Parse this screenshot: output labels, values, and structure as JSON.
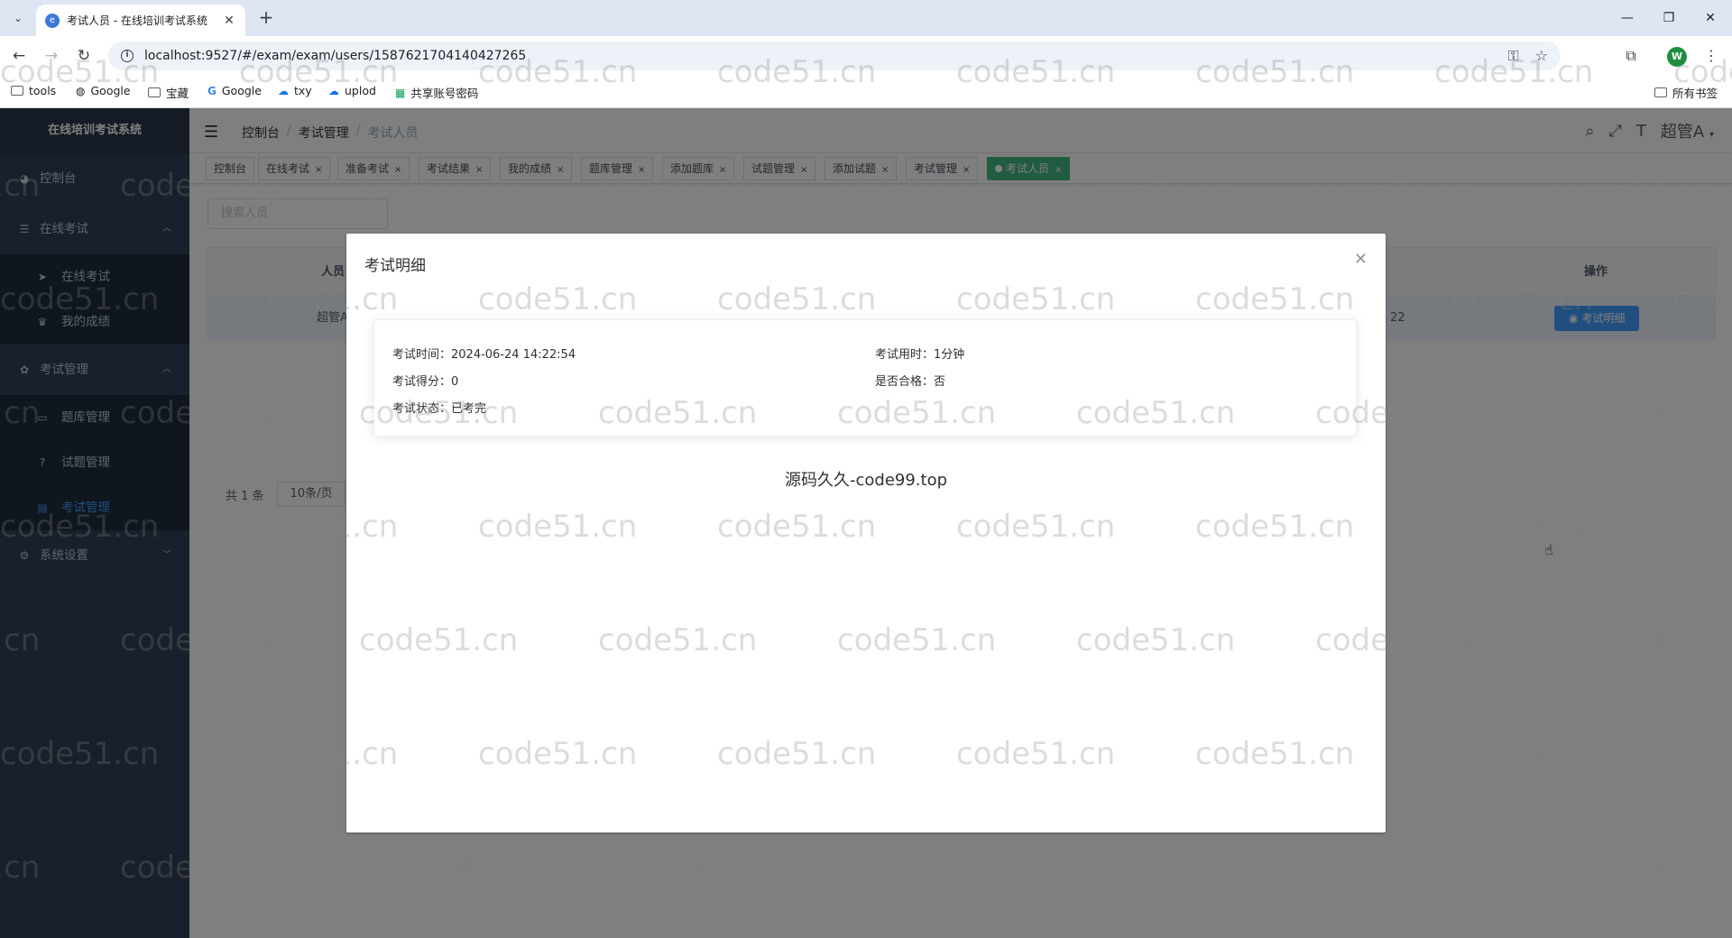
{
  "browser": {
    "tab_title": "考试人员 - 在线培训考试系统",
    "url": "localhost:9527/#/exam/exam/users/1587621704140427265",
    "profile_initial": "W",
    "bookmarks": [
      "tools",
      "Google",
      "宝藏",
      "Google",
      "txy",
      "uplod",
      "共享账号密码"
    ],
    "all_bookmarks": "所有书签"
  },
  "sidebar": {
    "logo": "在线培训考试系统",
    "items": [
      {
        "label": "控制台"
      },
      {
        "label": "在线考试"
      },
      {
        "label": "在线考试"
      },
      {
        "label": "我的成绩"
      },
      {
        "label": "考试管理"
      },
      {
        "label": "题库管理"
      },
      {
        "label": "试题管理"
      },
      {
        "label": "考试管理"
      },
      {
        "label": "系统设置"
      }
    ]
  },
  "navbar": {
    "breadcrumb": [
      "控制台",
      "考试管理",
      "考试人员"
    ],
    "separator": "/",
    "user": "超管A"
  },
  "tags": [
    "控制台",
    "在线考试",
    "准备考试",
    "考试结果",
    "我的成绩",
    "题库管理",
    "添加题库",
    "试题管理",
    "添加试题",
    "考试管理",
    "考试人员"
  ],
  "page": {
    "search_placeholder": "搜索人员",
    "columns": {
      "person": "人员",
      "action": "操作"
    },
    "row": {
      "person": "超管A",
      "time_tail": "22",
      "action": "考试明细"
    },
    "total": "共 1 条",
    "page_size": "10条/页"
  },
  "dialog": {
    "title": "考试明细",
    "exam_time_label": "考试时间：",
    "exam_time_value": "2024-06-24 14:22:54",
    "duration_label": "考试用时：",
    "duration_value": "1分钟",
    "score_label": "考试得分：",
    "score_value": "0",
    "passed_label": "是否合格：",
    "passed_value": "否",
    "status_label": "考试状态：",
    "status_value": "已考完",
    "footer_text": "源码久久-code99.top"
  },
  "watermark": "code51.cn"
}
